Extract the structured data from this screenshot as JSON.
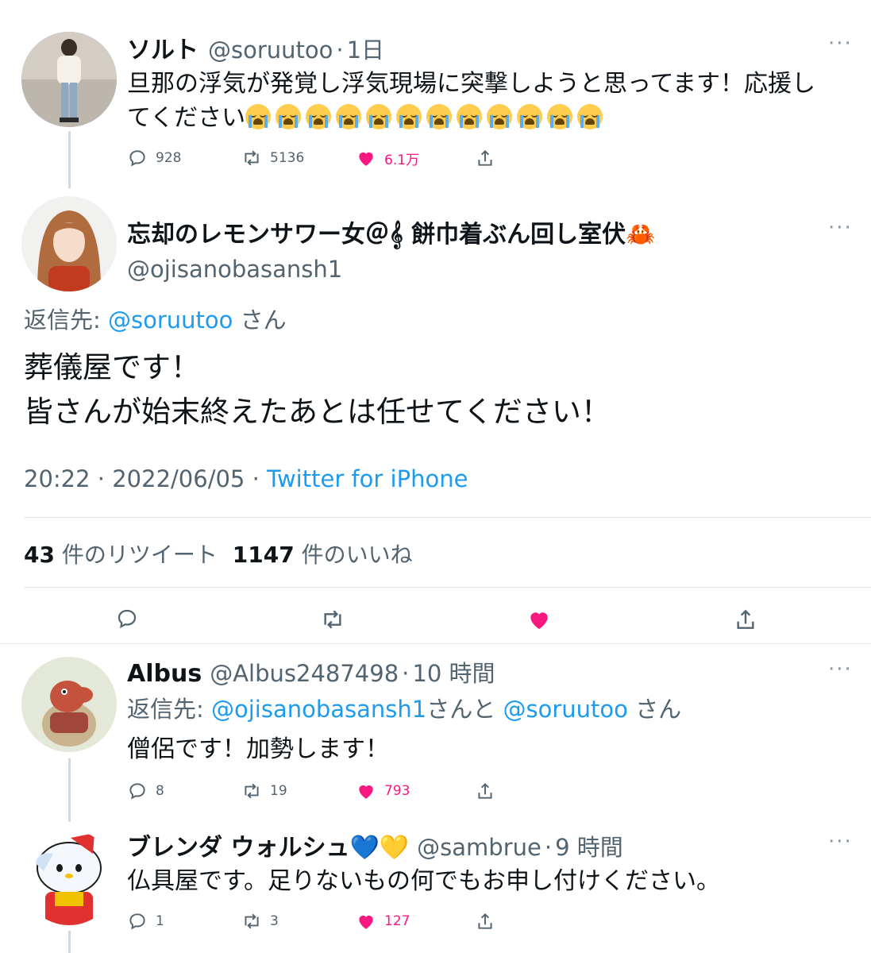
{
  "tweet1": {
    "name": "ソルト",
    "handle": "@soruutoo",
    "time": "1日",
    "text_line1": "旦那の浮気が発覚し浮気現場に突撃しようと思ってます！応援し",
    "text_line2": "てください",
    "emoji_name": "loudly-crying-face-icon",
    "emoji_count": 12,
    "replies": "928",
    "retweets": "5136",
    "likes": "6.1万"
  },
  "main_tweet": {
    "name": "忘却のレモンサワー女＠𝄞 餅巾着ぶん回し室伏🦀",
    "handle": "@ojisanobasansh1",
    "reply_prefix": "返信先:",
    "reply_to": "@soruutoo",
    "reply_suffix": "さん",
    "text_line1": "葬儀屋です！",
    "text_line2": "皆さんが始末終えたあとは任せてください！",
    "time": "20:22",
    "date": "2022/06/05",
    "client": "Twitter for iPhone",
    "retweet_count": "43",
    "retweet_label": "件のリツイート",
    "like_count": "1147",
    "like_label": "件のいいね"
  },
  "reply1": {
    "name": "Albus",
    "handle": "@Albus2487498",
    "time": "10 時間",
    "reply_prefix": "返信先:",
    "reply_to_1": "@ojisanobasansh1",
    "reply_mid": "さんと",
    "reply_to_2": "@soruutoo",
    "reply_suffix": "さん",
    "text": "僧侶です！加勢します！",
    "replies": "8",
    "retweets": "19",
    "likes": "793"
  },
  "reply2": {
    "name": "ブレンダ ウォルシュ💙💛",
    "handle": "@sambrue",
    "time": "9 時間",
    "text": "仏具屋です。足りないもの何でもお申し付けください。",
    "replies": "1",
    "retweets": "3",
    "likes": "127"
  },
  "separator": "·",
  "more_label": "···",
  "colors": {
    "accent": "#1d9bf0",
    "like": "#f91880",
    "secondary": "#536471"
  }
}
